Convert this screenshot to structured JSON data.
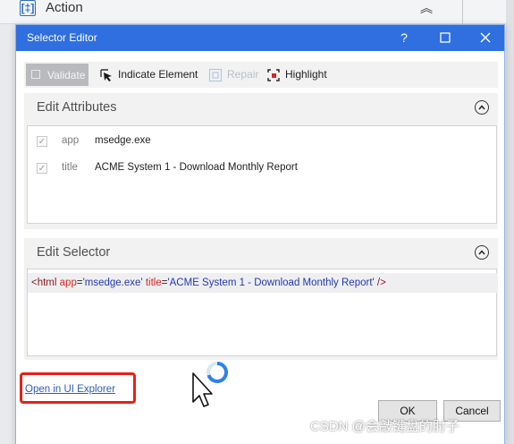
{
  "background": {
    "action_label": "Action",
    "action_icon_glyph": "[‡]",
    "collapse_glyph": "︽"
  },
  "dialog": {
    "title": "Selector Editor",
    "titlebar_buttons": {
      "help": "?",
      "maximize": "☐",
      "close": "✕"
    },
    "colors": {
      "titlebar": "#2f6fe0",
      "accent": "#2a5dbf",
      "highlight_box": "#e62117"
    }
  },
  "toolbar": {
    "validate": "Validate",
    "indicate": "Indicate Element",
    "repair": "Repair",
    "highlight": "Highlight"
  },
  "edit_attributes": {
    "title": "Edit Attributes",
    "rows": [
      {
        "checked": true,
        "name": "app",
        "value": "msedge.exe"
      },
      {
        "checked": true,
        "name": "title",
        "value": "ACME System 1 - Download Monthly Report"
      }
    ]
  },
  "edit_selector": {
    "title": "Edit Selector",
    "parts": {
      "open_tag": "<html",
      "attr1_name": "app",
      "eq1": "=",
      "attr1_value": "'msedge.exe'",
      "attr2_name": "title",
      "eq2": "=",
      "attr2_value": "'ACME System 1 - Download Monthly Report'",
      "close_tag": " />"
    }
  },
  "footer": {
    "open_link": "Open in UI Explorer",
    "ok": "OK",
    "cancel": "Cancel"
  },
  "watermark": "CSDN @会敲键盘的肘子"
}
